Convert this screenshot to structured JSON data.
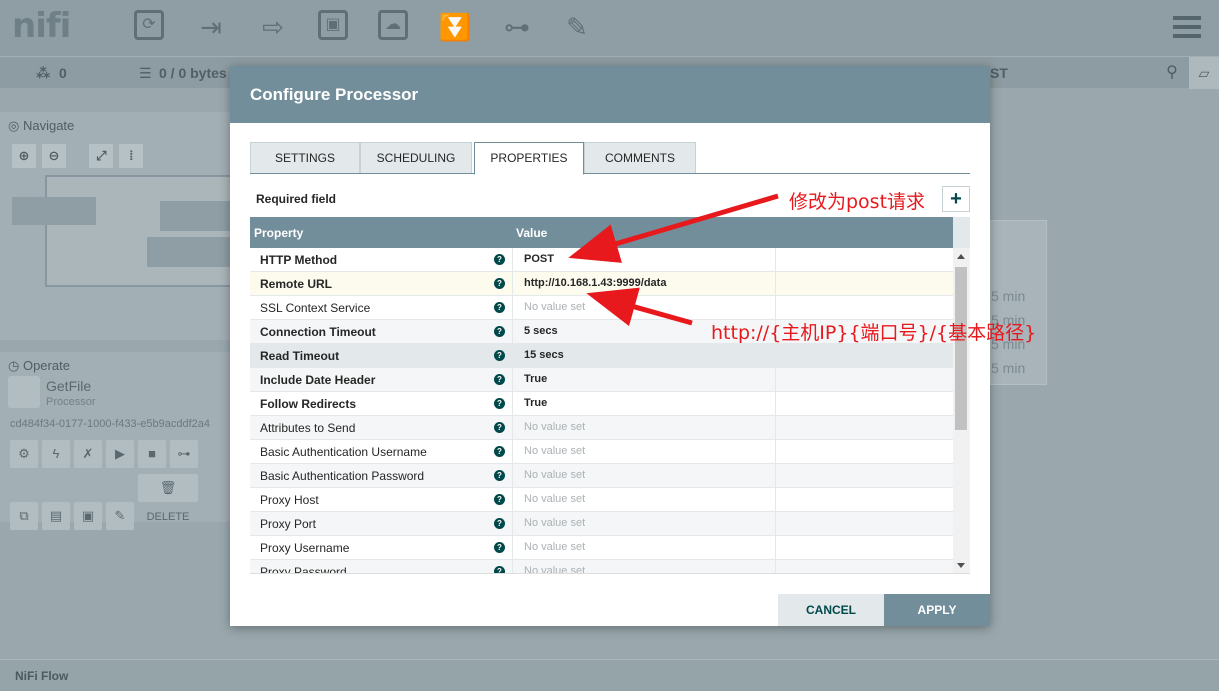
{
  "app": {
    "logo": "nifi",
    "status": {
      "threads": "0",
      "queued": "0 / 0 bytes",
      "fragment": "ST"
    },
    "navigate_title": "Navigate",
    "operate_title": "Operate",
    "component_name": "GetFile",
    "component_type": "Processor",
    "component_id": "cd484f34-0177-1000-f433-e5b9acddf2a4",
    "delete_label": "DELETE",
    "canvas_stats": [
      "5 min",
      "5 min",
      "5 min",
      "5 min"
    ],
    "footer": "NiFi Flow"
  },
  "dialog": {
    "title": "Configure Processor",
    "tabs": [
      "SETTINGS",
      "SCHEDULING",
      "PROPERTIES",
      "COMMENTS"
    ],
    "active_tab": "PROPERTIES",
    "required_label": "Required field",
    "add_button": "+",
    "columns": {
      "property": "Property",
      "value": "Value"
    },
    "rows": [
      {
        "name": "HTTP Method",
        "value": "POST",
        "required": true
      },
      {
        "name": "Remote URL",
        "value": "http://10.168.1.43:9999/data",
        "required": true
      },
      {
        "name": "SSL Context Service",
        "value": "No value set",
        "required": false
      },
      {
        "name": "Connection Timeout",
        "value": "5 secs",
        "required": true
      },
      {
        "name": "Read Timeout",
        "value": "15 secs",
        "required": true
      },
      {
        "name": "Include Date Header",
        "value": "True",
        "required": true
      },
      {
        "name": "Follow Redirects",
        "value": "True",
        "required": true
      },
      {
        "name": "Attributes to Send",
        "value": "No value set",
        "required": false
      },
      {
        "name": "Basic Authentication Username",
        "value": "No value set",
        "required": false
      },
      {
        "name": "Basic Authentication Password",
        "value": "No value set",
        "required": false
      },
      {
        "name": "Proxy Host",
        "value": "No value set",
        "required": false
      },
      {
        "name": "Proxy Port",
        "value": "No value set",
        "required": false
      },
      {
        "name": "Proxy Username",
        "value": "No value set",
        "required": false
      },
      {
        "name": "Proxy Password",
        "value": "No value set",
        "required": false
      }
    ],
    "cancel": "CANCEL",
    "apply": "APPLY"
  },
  "annotations": {
    "post_note": "修改为post请求",
    "url_note": "http://{主机IP}{端口号}/{基本路径}",
    "color": "#e8191d"
  },
  "colors": {
    "header": "#728e9b",
    "accent": "#004849"
  }
}
